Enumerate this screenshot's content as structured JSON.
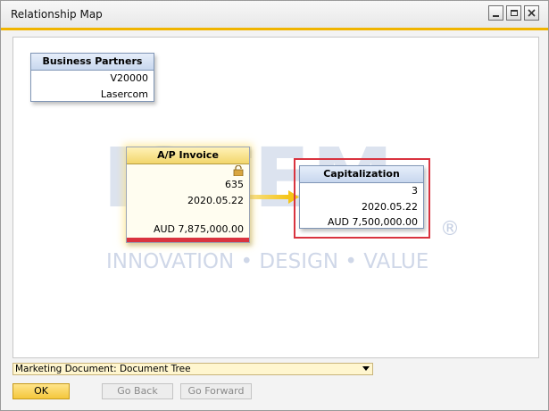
{
  "window": {
    "title": "Relationship Map",
    "controls": {
      "minimize": "minimize-icon",
      "maximize": "maximize-icon",
      "close": "close-icon"
    }
  },
  "watermark": {
    "logo": "ISTEM",
    "tagline": "INNOVATION • DESIGN • VALUE",
    "registered": "®"
  },
  "nodes": {
    "business_partners": {
      "title": "Business Partners",
      "code": "V20000",
      "name": "Lasercom"
    },
    "ap_invoice": {
      "title": "A/P Invoice",
      "icon": "lock-icon",
      "number": "635",
      "date": "2020.05.22",
      "amount": "AUD 7,875,000.00"
    },
    "capitalization": {
      "title": "Capitalization",
      "number": "3",
      "date": "2020.05.22",
      "amount": "AUD 7,500,000.00"
    }
  },
  "footer": {
    "dropdown_value": "Marketing Document: Document Tree",
    "ok_label": "OK",
    "go_back_label": "Go Back",
    "go_forward_label": "Go Forward"
  },
  "colors": {
    "accent": "#f0b400",
    "highlight_border": "#d9333f",
    "arrow": "#f5c518",
    "card_header": "#c8d7ee"
  }
}
